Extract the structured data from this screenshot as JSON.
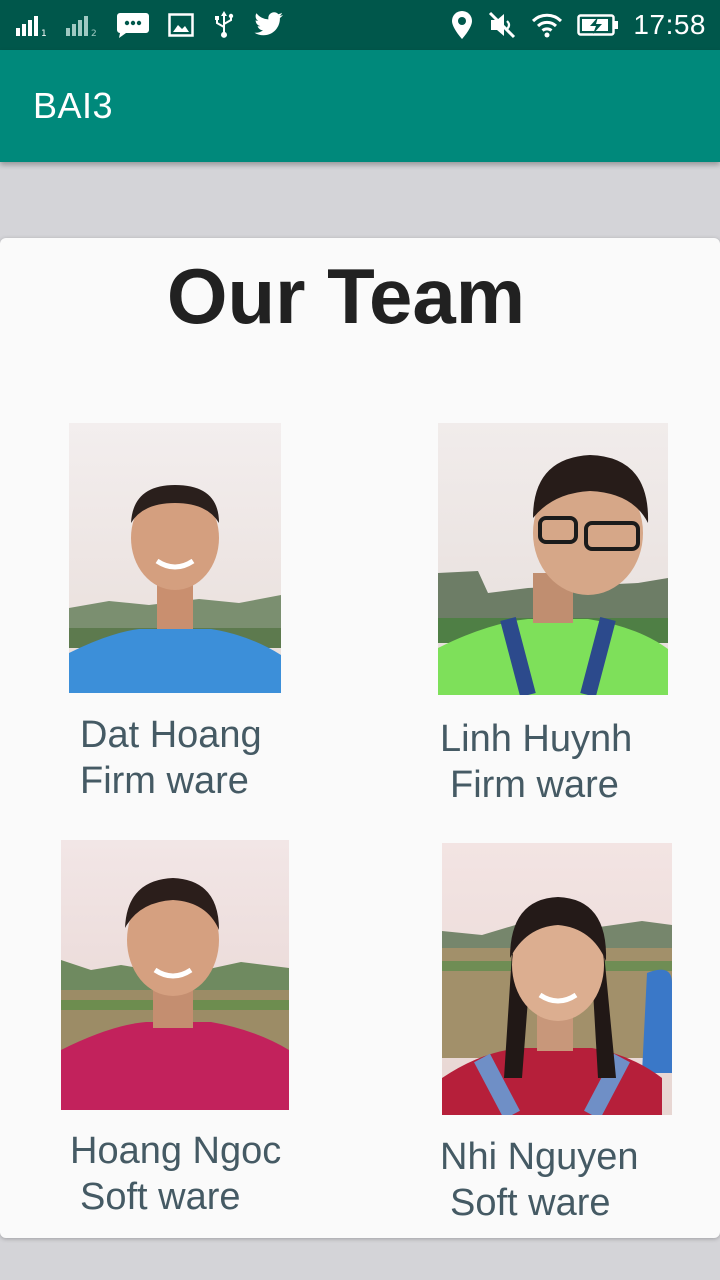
{
  "status_bar": {
    "time": "17:58",
    "icons": [
      "signal-sim1-icon",
      "signal-sim2-icon",
      "sms-icon",
      "image-icon",
      "usb-icon",
      "twitter-icon",
      "location-icon",
      "mute-icon",
      "wifi-icon",
      "battery-charging-icon"
    ]
  },
  "app_bar": {
    "title": "BAI3"
  },
  "page": {
    "heading": "Our Team",
    "members": [
      {
        "name": "Dat Hoang",
        "role": "Firm ware",
        "photo": "person-photo"
      },
      {
        "name": "Linh Huynh",
        "role": "Firm ware",
        "photo": "person-photo"
      },
      {
        "name": "Hoang Ngoc",
        "role": "Soft ware",
        "photo": "person-photo"
      },
      {
        "name": "Nhi Nguyen",
        "role": "Soft ware",
        "photo": "person-photo"
      }
    ]
  },
  "colors": {
    "status_bar": "#00574b",
    "app_bar": "#00897b",
    "background": "#d4d4d8",
    "card": "#fafafa",
    "member_text": "#455a64"
  }
}
